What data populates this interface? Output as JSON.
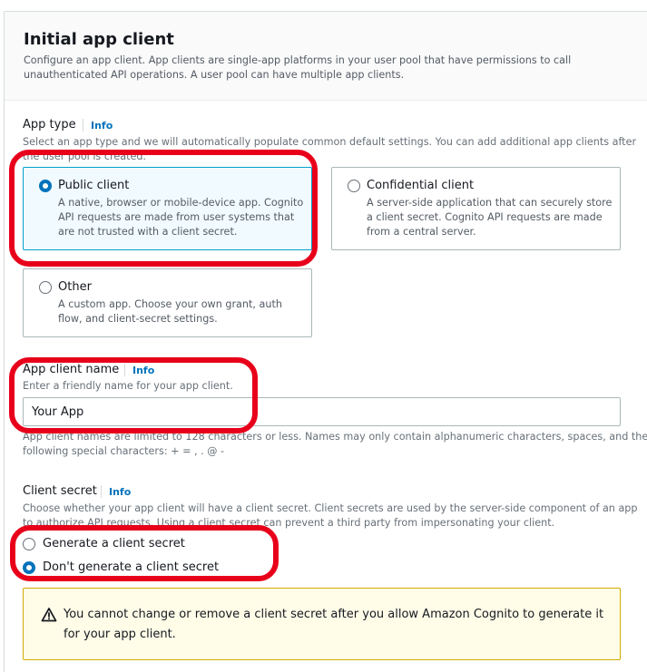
{
  "section": {
    "title": "Initial app client",
    "description": "Configure an app client. App clients are single-app platforms in your user pool that have permissions to call unauthenticated API operations. A user pool can have multiple app clients."
  },
  "app_type": {
    "label": "App type",
    "info": "Info",
    "description_line1": "Select an app type and we will automatically populate common default settings. You can add additional app clients after",
    "description_line2": "the user pool is created.",
    "options": [
      {
        "title": "Public client",
        "desc1": "A native, browser or mobile-device app. Cognito",
        "desc2": "API requests are made from user systems that",
        "desc3": "are not trusted with a client secret.",
        "selected": true
      },
      {
        "title": "Confidential client",
        "desc1": "A server-side application that can securely store",
        "desc2": "a client secret. Cognito API requests are made",
        "desc3": "from a central server.",
        "selected": false
      },
      {
        "title": "Other",
        "desc1": "A custom app. Choose your own grant, auth",
        "desc2": "flow, and client-secret settings.",
        "selected": false
      }
    ]
  },
  "app_client_name": {
    "label": "App client name",
    "info": "Info",
    "description": "Enter a friendly name for your app client.",
    "value": "Your App",
    "constraint_line1": "App client names are limited to 128 characters or less. Names may only contain alphanumeric characters, spaces, and the",
    "constraint_line2": "following special characters: + = , . @ -"
  },
  "client_secret": {
    "label": "Client secret",
    "info": "Info",
    "description_line1": "Choose whether your app client will have a client secret. Client secrets are used by the server-side component of an app",
    "description_line2": "to authorize API requests. Using a client secret can prevent a third party from impersonating your client.",
    "options": [
      {
        "label": "Generate a client secret",
        "selected": false
      },
      {
        "label": "Don't generate a client secret",
        "selected": true
      }
    ]
  },
  "alert": {
    "icon": "warning-icon",
    "text": "You cannot change or remove a client secret after you allow Amazon Cognito to generate it for your app client."
  },
  "colors": {
    "accent": "#0073bb",
    "annotation": "#e8001b",
    "warning_border": "#d1ad00",
    "warning_bg": "#fffce8"
  }
}
